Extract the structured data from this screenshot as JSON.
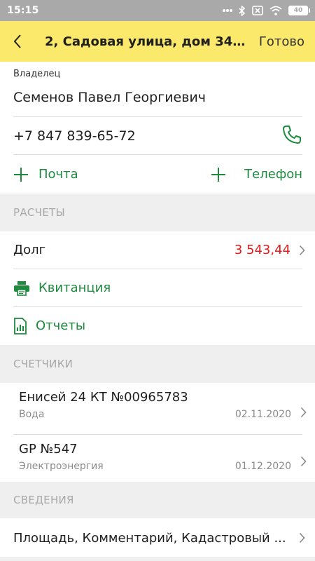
{
  "status_bar": {
    "time": "15:15",
    "battery": "40"
  },
  "app_bar": {
    "title": "2, Садовая улица, дом 34 (...",
    "done_label": "Готово"
  },
  "owner": {
    "label": "Владелец",
    "name": "Семенов Павел Георгиевич",
    "phone": "+7 847 839-65-72",
    "add_mail_label": "Почта",
    "add_phone_label": "Телефон"
  },
  "sections": {
    "payments": "РАСЧЕТЫ",
    "meters": "СЧЕТЧИКИ",
    "info": "СВЕДЕНИЯ"
  },
  "payments": {
    "debt_label": "Долг",
    "debt_value": "3 543,44",
    "receipt_label": "Квитанция",
    "reports_label": "Отчеты"
  },
  "meters": [
    {
      "name": "Енисей 24 КТ №00965783",
      "type": "Вода",
      "date": "02.11.2020"
    },
    {
      "name": "GP №547",
      "type": "Электроэнергия",
      "date": "01.12.2020"
    }
  ],
  "info": {
    "row_label": "Площадь, Комментарий, Кадастровый ..."
  },
  "colors": {
    "accent_green": "#1e8a3e",
    "debt_red": "#e41b1b",
    "appbar_yellow": "#fbe96b",
    "statusbar_gray": "#a9a9a9"
  }
}
